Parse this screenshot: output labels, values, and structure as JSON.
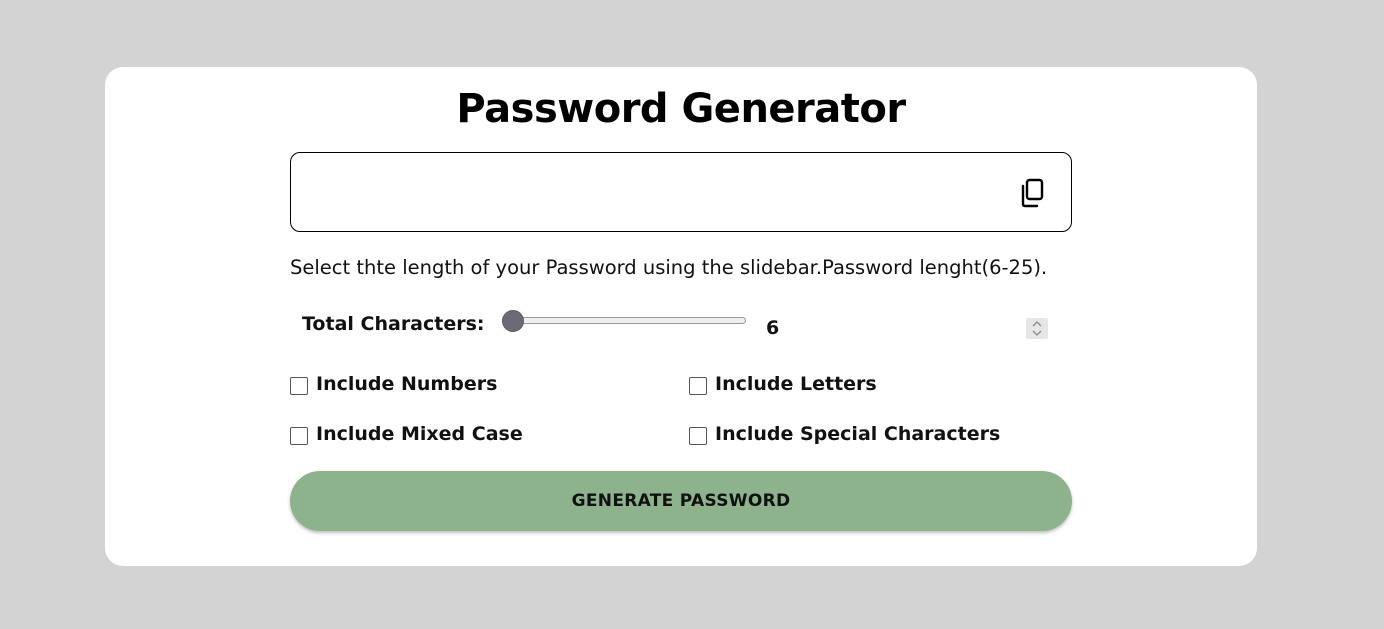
{
  "page": {
    "title": "Password Generator"
  },
  "output": {
    "value": "",
    "copy_icon": "copy-icon"
  },
  "instructions": "Select thte length of your Password using the slidebar.Password lenght(6-25).",
  "length": {
    "label": "Total Characters:",
    "min": 6,
    "max": 25,
    "value": "6",
    "slider_fraction": 0
  },
  "options": {
    "numbers": {
      "label": "Include Numbers",
      "checked": false
    },
    "letters": {
      "label": "Include Letters",
      "checked": false
    },
    "mixed_case": {
      "label": "Include Mixed Case",
      "checked": false
    },
    "special": {
      "label": "Include Special Characters",
      "checked": false
    }
  },
  "generate_button": {
    "label": "GENERATE PASSWORD"
  },
  "colors": {
    "background": "#d3d3d3",
    "card": "#ffffff",
    "button": "#8db38d",
    "slider_thumb": "#6b6b78"
  }
}
